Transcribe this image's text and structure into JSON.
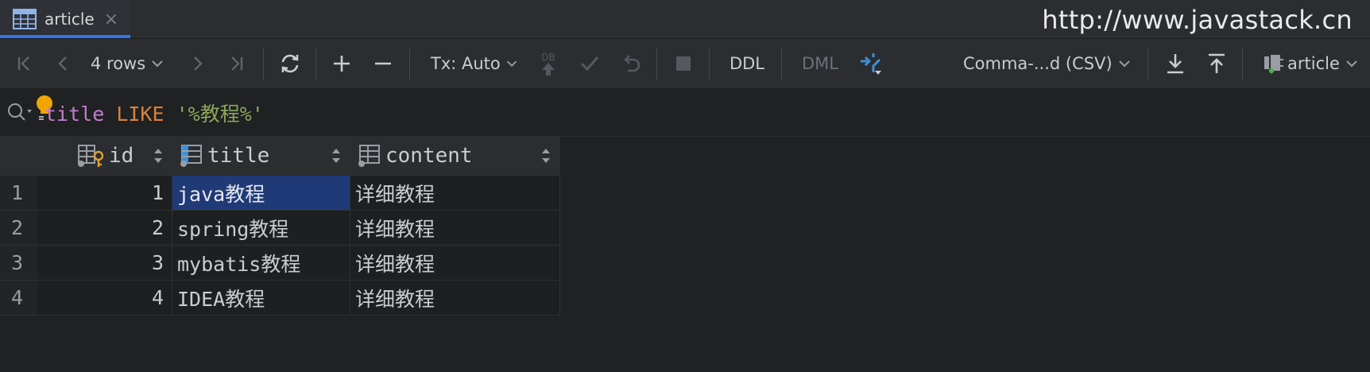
{
  "tab": {
    "title": "article",
    "close": "×"
  },
  "watermark": "http://www.javastack.cn",
  "toolbar": {
    "rows_label": "4 rows",
    "tx_label": "Tx: Auto",
    "db_badge": "DB",
    "ddl": "DDL",
    "dml": "DML",
    "format_label": "Comma-...d (CSV)",
    "table_label": "article"
  },
  "filter": {
    "column": "title",
    "operator": "LIKE",
    "value": "'%教程%'"
  },
  "table": {
    "columns": [
      "id",
      "title",
      "content"
    ],
    "rows": [
      {
        "num": "1",
        "id": "1",
        "title": "java教程",
        "content": "详细教程"
      },
      {
        "num": "2",
        "id": "2",
        "title": "spring教程",
        "content": "详细教程"
      },
      {
        "num": "3",
        "id": "3",
        "title": "mybatis教程",
        "content": "详细教程"
      },
      {
        "num": "4",
        "id": "4",
        "title": "IDEA教程",
        "content": "详细教程"
      }
    ]
  },
  "colors": {
    "background": "#202122",
    "toolbar": "#2b2d30",
    "accent": "#3574f0",
    "selection": "#1f3a77",
    "keyword_column": "#c27ed0",
    "keyword_operator": "#d9823b",
    "keyword_string": "#8aa65a"
  }
}
